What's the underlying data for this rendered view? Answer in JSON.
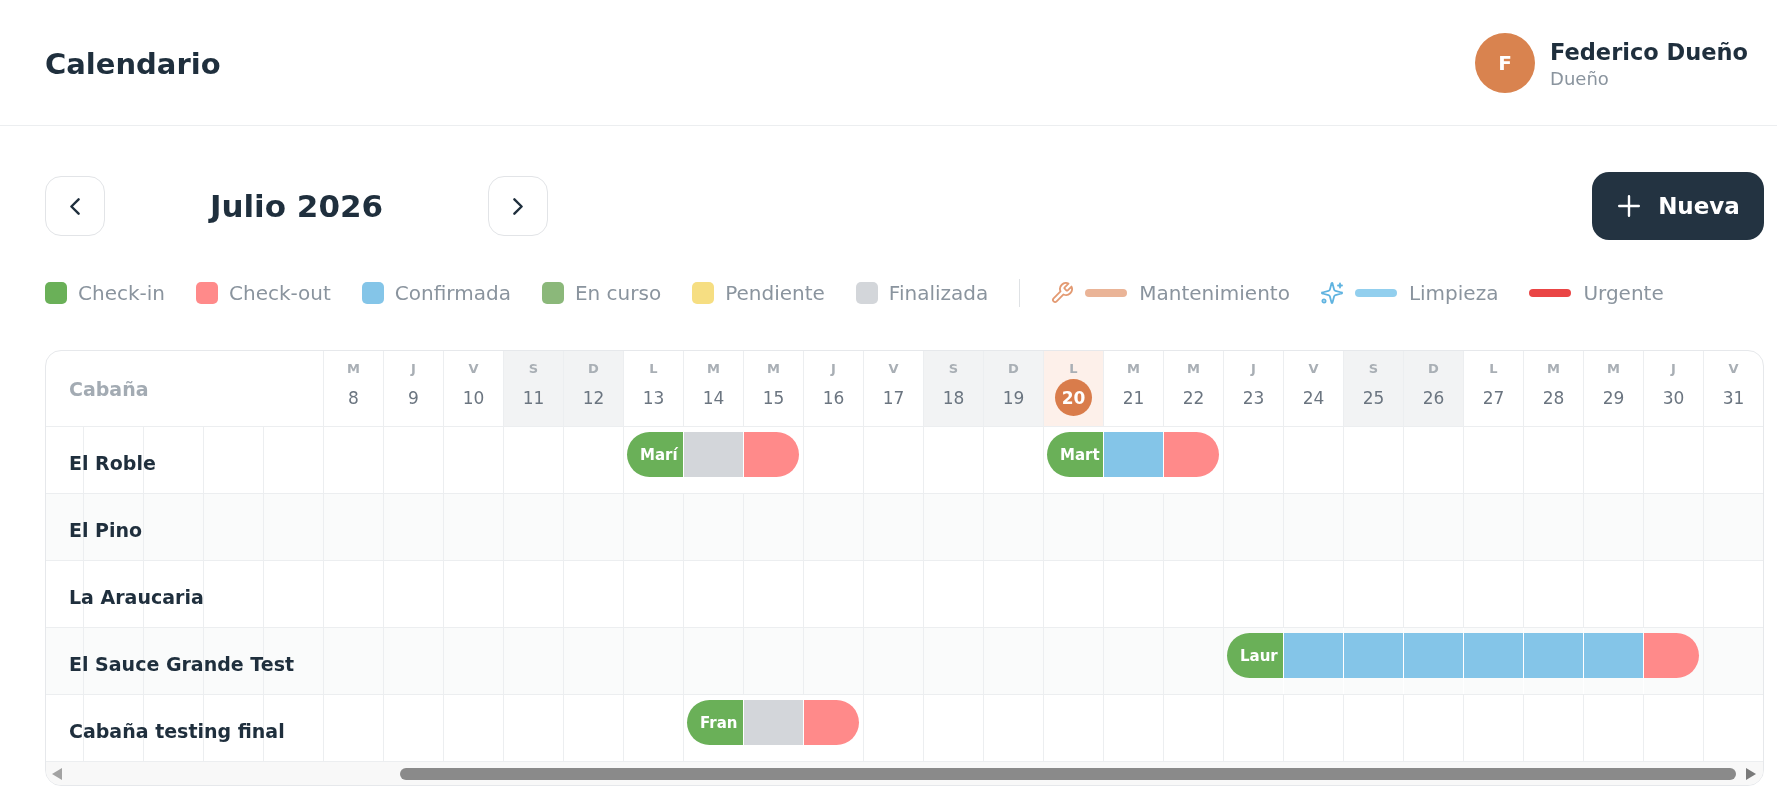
{
  "header": {
    "title": "Calendario",
    "user": {
      "initial": "F",
      "name": "Federico Dueño",
      "role": "Dueño"
    }
  },
  "toolbar": {
    "month": "Julio 2026",
    "new_button": {
      "label": "Nueva"
    }
  },
  "legend": {
    "statuses": [
      {
        "label": "Check-in",
        "kind": "check-in",
        "color": "#6ab058"
      },
      {
        "label": "Check-out",
        "kind": "check-out",
        "color": "#ff8a8a"
      },
      {
        "label": "Confirmada",
        "kind": "confirmada",
        "color": "#84c5e8"
      },
      {
        "label": "En curso",
        "kind": "en-curso",
        "color": "#8bb87a"
      },
      {
        "label": "Pendiente",
        "kind": "pendiente",
        "color": "#f6de82"
      },
      {
        "label": "Finalizada",
        "kind": "finalizada",
        "color": "#d3d6da"
      }
    ],
    "tasks": [
      {
        "label": "Mantenimiento",
        "kind": "maintenance",
        "color": "#eab497"
      },
      {
        "label": "Limpieza",
        "kind": "cleaning",
        "color": "#92cfee"
      },
      {
        "label": "Urgente",
        "kind": "urgent",
        "color": "#ea4545"
      }
    ]
  },
  "calendar": {
    "column_heading": "Cabaña",
    "days": [
      {
        "weekday": "M",
        "day": "8",
        "weekend": false,
        "today": false
      },
      {
        "weekday": "J",
        "day": "9",
        "weekend": false,
        "today": false
      },
      {
        "weekday": "V",
        "day": "10",
        "weekend": false,
        "today": false
      },
      {
        "weekday": "S",
        "day": "11",
        "weekend": true,
        "today": false
      },
      {
        "weekday": "D",
        "day": "12",
        "weekend": true,
        "today": false
      },
      {
        "weekday": "L",
        "day": "13",
        "weekend": false,
        "today": false
      },
      {
        "weekday": "M",
        "day": "14",
        "weekend": false,
        "today": false
      },
      {
        "weekday": "M",
        "day": "15",
        "weekend": false,
        "today": false
      },
      {
        "weekday": "J",
        "day": "16",
        "weekend": false,
        "today": false
      },
      {
        "weekday": "V",
        "day": "17",
        "weekend": false,
        "today": false
      },
      {
        "weekday": "S",
        "day": "18",
        "weekend": true,
        "today": false
      },
      {
        "weekday": "D",
        "day": "19",
        "weekend": true,
        "today": false
      },
      {
        "weekday": "L",
        "day": "20",
        "weekend": false,
        "today": true
      },
      {
        "weekday": "M",
        "day": "21",
        "weekend": false,
        "today": false
      },
      {
        "weekday": "M",
        "day": "22",
        "weekend": false,
        "today": false
      },
      {
        "weekday": "J",
        "day": "23",
        "weekend": false,
        "today": false
      },
      {
        "weekday": "V",
        "day": "24",
        "weekend": false,
        "today": false
      },
      {
        "weekday": "S",
        "day": "25",
        "weekend": true,
        "today": false
      },
      {
        "weekday": "D",
        "day": "26",
        "weekend": true,
        "today": false
      },
      {
        "weekday": "L",
        "day": "27",
        "weekend": false,
        "today": false
      },
      {
        "weekday": "M",
        "day": "28",
        "weekend": false,
        "today": false
      },
      {
        "weekday": "M",
        "day": "29",
        "weekend": false,
        "today": false
      },
      {
        "weekday": "J",
        "day": "30",
        "weekend": false,
        "today": false
      },
      {
        "weekday": "V",
        "day": "31",
        "weekend": false,
        "today": false
      }
    ],
    "rows": [
      {
        "name": "El Roble",
        "cells": [
          {
            "kind": "free"
          },
          {
            "kind": "free"
          },
          {
            "kind": "free"
          },
          {
            "kind": "free"
          },
          {
            "kind": "free"
          },
          {
            "kind": "check-in",
            "guest": "Marí"
          },
          {
            "kind": "finalizada"
          },
          {
            "kind": "check-out"
          },
          {
            "kind": "free"
          },
          {
            "kind": "free"
          },
          {
            "kind": "free"
          },
          {
            "kind": "free"
          },
          {
            "kind": "check-in",
            "guest": "Mart"
          },
          {
            "kind": "confirmada"
          },
          {
            "kind": "check-out"
          },
          {
            "kind": "free"
          },
          {
            "kind": "free"
          },
          {
            "kind": "free"
          },
          {
            "kind": "free"
          },
          {
            "kind": "free"
          },
          {
            "kind": "free"
          },
          {
            "kind": "free"
          },
          {
            "kind": "free"
          },
          {
            "kind": "free"
          }
        ]
      },
      {
        "name": "El Pino",
        "cells": [
          {
            "kind": "free"
          },
          {
            "kind": "free"
          },
          {
            "kind": "free"
          },
          {
            "kind": "free"
          },
          {
            "kind": "free"
          },
          {
            "kind": "free"
          },
          {
            "kind": "free"
          },
          {
            "kind": "free"
          },
          {
            "kind": "free"
          },
          {
            "kind": "free"
          },
          {
            "kind": "free"
          },
          {
            "kind": "free"
          },
          {
            "kind": "free"
          },
          {
            "kind": "free"
          },
          {
            "kind": "free"
          },
          {
            "kind": "free"
          },
          {
            "kind": "free"
          },
          {
            "kind": "free"
          },
          {
            "kind": "free"
          },
          {
            "kind": "free"
          },
          {
            "kind": "free"
          },
          {
            "kind": "free"
          },
          {
            "kind": "free"
          },
          {
            "kind": "free"
          }
        ]
      },
      {
        "name": "La Araucaria",
        "cells": [
          {
            "kind": "free"
          },
          {
            "kind": "free"
          },
          {
            "kind": "free"
          },
          {
            "kind": "free"
          },
          {
            "kind": "free"
          },
          {
            "kind": "free"
          },
          {
            "kind": "free"
          },
          {
            "kind": "free"
          },
          {
            "kind": "free"
          },
          {
            "kind": "free"
          },
          {
            "kind": "free"
          },
          {
            "kind": "free"
          },
          {
            "kind": "free"
          },
          {
            "kind": "free"
          },
          {
            "kind": "free"
          },
          {
            "kind": "free"
          },
          {
            "kind": "free"
          },
          {
            "kind": "free"
          },
          {
            "kind": "free"
          },
          {
            "kind": "free"
          },
          {
            "kind": "free"
          },
          {
            "kind": "free"
          },
          {
            "kind": "free"
          },
          {
            "kind": "free"
          }
        ]
      },
      {
        "name": "El Sauce Grande Test",
        "cells": [
          {
            "kind": "free"
          },
          {
            "kind": "free"
          },
          {
            "kind": "free"
          },
          {
            "kind": "free"
          },
          {
            "kind": "free"
          },
          {
            "kind": "free"
          },
          {
            "kind": "free"
          },
          {
            "kind": "free"
          },
          {
            "kind": "free"
          },
          {
            "kind": "free"
          },
          {
            "kind": "free"
          },
          {
            "kind": "free"
          },
          {
            "kind": "free"
          },
          {
            "kind": "free"
          },
          {
            "kind": "free"
          },
          {
            "kind": "check-in",
            "guest": "Laur"
          },
          {
            "kind": "confirmada"
          },
          {
            "kind": "confirmada"
          },
          {
            "kind": "confirmada"
          },
          {
            "kind": "confirmada"
          },
          {
            "kind": "confirmada"
          },
          {
            "kind": "confirmada"
          },
          {
            "kind": "check-out"
          },
          {
            "kind": "free"
          }
        ]
      },
      {
        "name": "Cabaña testing final",
        "cells": [
          {
            "kind": "free"
          },
          {
            "kind": "free"
          },
          {
            "kind": "free"
          },
          {
            "kind": "free"
          },
          {
            "kind": "free"
          },
          {
            "kind": "free"
          },
          {
            "kind": "check-in",
            "guest": "Fran"
          },
          {
            "kind": "finalizada"
          },
          {
            "kind": "check-out"
          },
          {
            "kind": "free"
          },
          {
            "kind": "free"
          },
          {
            "kind": "free"
          },
          {
            "kind": "free"
          },
          {
            "kind": "free"
          },
          {
            "kind": "free"
          },
          {
            "kind": "free"
          },
          {
            "kind": "free"
          },
          {
            "kind": "free"
          },
          {
            "kind": "free"
          },
          {
            "kind": "free"
          },
          {
            "kind": "free"
          },
          {
            "kind": "free"
          },
          {
            "kind": "free"
          },
          {
            "kind": "free"
          }
        ]
      }
    ]
  }
}
